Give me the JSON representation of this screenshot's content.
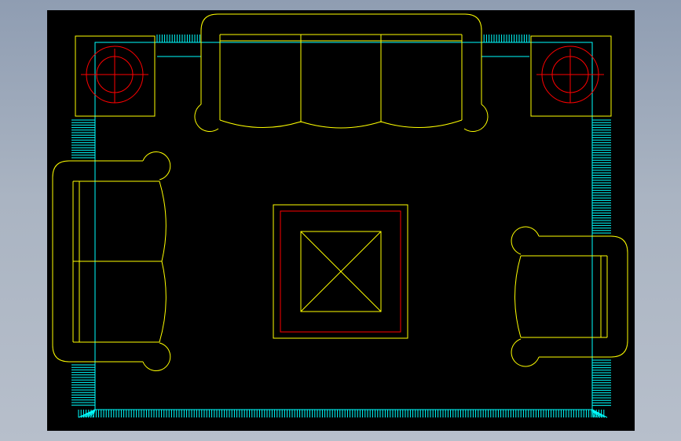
{
  "drawing": {
    "background": "#000000",
    "colors": {
      "furniture": "#ffff00",
      "lamps": "#ff0000",
      "rug_fringe": "#00ffff",
      "table_inner": "#ff0000"
    },
    "objects": [
      "rug-with-fringe",
      "three-seat-sofa",
      "loveseat-left",
      "armchair-right",
      "end-table-left-with-lamp",
      "end-table-right-with-lamp",
      "coffee-table"
    ]
  }
}
